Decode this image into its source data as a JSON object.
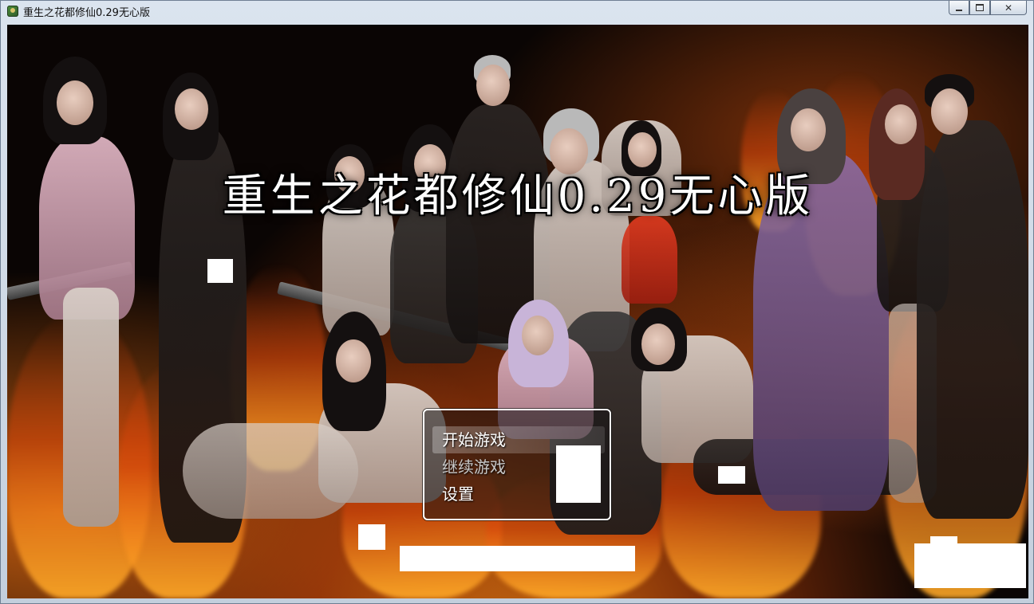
{
  "window": {
    "title": "重生之花都修仙0.29无心版",
    "controls": {
      "minimize": "minimize-icon",
      "maximize": "maximize-icon",
      "close": "close-icon"
    }
  },
  "game": {
    "title": "重生之花都修仙0.29无心版"
  },
  "menu": {
    "items": [
      {
        "label": "开始游戏",
        "selected": true
      },
      {
        "label": "继续游戏",
        "selected": false
      },
      {
        "label": "设置",
        "selected": false
      }
    ]
  },
  "colors": {
    "background": "#0a0504",
    "fire": "#ff8a1e",
    "window_frame": "#c3cfdd"
  }
}
